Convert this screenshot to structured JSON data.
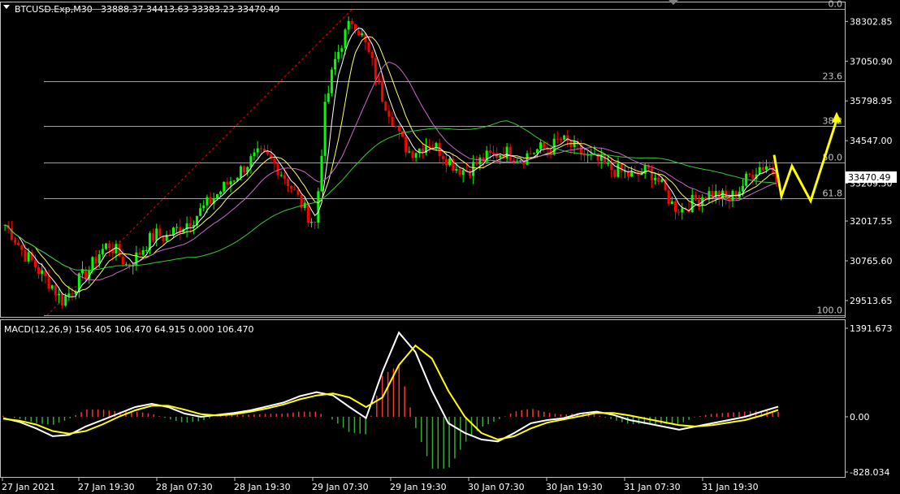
{
  "header": {
    "symbol_label": "BTCUSD.Exp,M30",
    "ohlc": "33888.37 34413.63 33383.23 33470.49"
  },
  "macd_header": "MACD(12,26,9) 156.405 106.470 64.915 0.000 106.470",
  "price_tag": "33470.49",
  "colors": {
    "background": "#000000",
    "frame": "#c0c0c0",
    "candle_up": "#00ff00",
    "candle_down": "#ff0000",
    "fib_line": "#a0a0a0",
    "fib_trend": "#ff0000",
    "ma_fast": "#ffffff",
    "ma_mid": "#ffff66",
    "ma_slow": "#cc66cc",
    "ma_long": "#33cc33",
    "macd_line": "#ffffff",
    "signal_line": "#ffff00",
    "hist_up": "#ff3333",
    "hist_down": "#33aa33",
    "forecast_arrow": "#ffff00"
  },
  "chart_data": [
    {
      "type": "candlestick",
      "title": "BTCUSD.Exp,M30",
      "ylim": [
        29000,
        38900
      ],
      "price_axis_ticks": [
        "38302.85",
        "37050.90",
        "35798.95",
        "34547.00",
        "33209.50",
        "32017.55",
        "30765.60",
        "29513.65"
      ],
      "price_axis_values": [
        38302.85,
        37050.9,
        35798.95,
        34547.0,
        33209.5,
        32017.55,
        30765.6,
        29513.65
      ],
      "time_labels": [
        "27 Jan 2021",
        "27 Jan 19:30",
        "28 Jan 07:30",
        "28 Jan 19:30",
        "29 Jan 07:30",
        "29 Jan 19:30",
        "30 Jan 07:30",
        "30 Jan 19:30",
        "31 Jan 07:30",
        "31 Jan 19:30"
      ],
      "fib_levels": [
        {
          "label": "0.0",
          "price": 38700
        },
        {
          "label": "23.6",
          "price": 36420
        },
        {
          "label": "38.2",
          "price": 35000
        },
        {
          "label": "50.0",
          "price": 33870
        },
        {
          "label": "61.8",
          "price": 32730
        },
        {
          "label": "100.0",
          "price": 29050
        }
      ],
      "close_path": [
        31900,
        31500,
        31000,
        30700,
        30300,
        30000,
        29500,
        29800,
        30200,
        30500,
        31000,
        31300,
        31000,
        30600,
        30900,
        31300,
        31600,
        31500,
        31700,
        31900,
        32100,
        32400,
        32700,
        33000,
        33300,
        33600,
        33900,
        34100,
        34000,
        33700,
        33300,
        32800,
        32300,
        31900,
        35500,
        37000,
        37800,
        38400,
        37800,
        37000,
        36000,
        35400,
        34600,
        34200,
        34300,
        34500,
        34300,
        34000,
        33700,
        33600,
        33800,
        34000,
        34100,
        34200,
        34100,
        34000,
        34200,
        34300,
        34300,
        34600,
        34400,
        34200,
        34000,
        33900,
        33700,
        33600,
        33500,
        33400,
        33600,
        33500,
        33000,
        32500,
        32400,
        32600,
        32800,
        32900,
        32800,
        32700,
        33000,
        33400,
        33700,
        33800,
        33470
      ]
    },
    {
      "type": "line",
      "title": "MACD(12,26,9)",
      "ylim": [
        -828.034,
        1391.673
      ],
      "axis_ticks": [
        "1391.673",
        "0.00",
        "-828.034"
      ],
      "series": [
        {
          "name": "MACD",
          "values": [
            -20,
            -80,
            -180,
            -300,
            -280,
            -150,
            -50,
            50,
            150,
            200,
            150,
            50,
            0,
            30,
            60,
            100,
            160,
            220,
            320,
            380,
            330,
            150,
            -20,
            700,
            1300,
            1000,
            400,
            -100,
            -250,
            -350,
            -380,
            -250,
            -100,
            -50,
            -20,
            50,
            80,
            30,
            -50,
            -100,
            -150,
            -200,
            -150,
            -100,
            -50,
            0,
            80,
            156
          ]
        },
        {
          "name": "Signal",
          "values": [
            -30,
            -60,
            -120,
            -220,
            -260,
            -220,
            -120,
            0,
            100,
            170,
            170,
            110,
            40,
            20,
            40,
            80,
            130,
            190,
            270,
            330,
            360,
            300,
            150,
            300,
            800,
            1100,
            900,
            400,
            0,
            -250,
            -350,
            -300,
            -180,
            -90,
            -40,
            10,
            60,
            60,
            20,
            -30,
            -80,
            -130,
            -150,
            -130,
            -90,
            -50,
            20,
            106
          ]
        }
      ]
    }
  ]
}
